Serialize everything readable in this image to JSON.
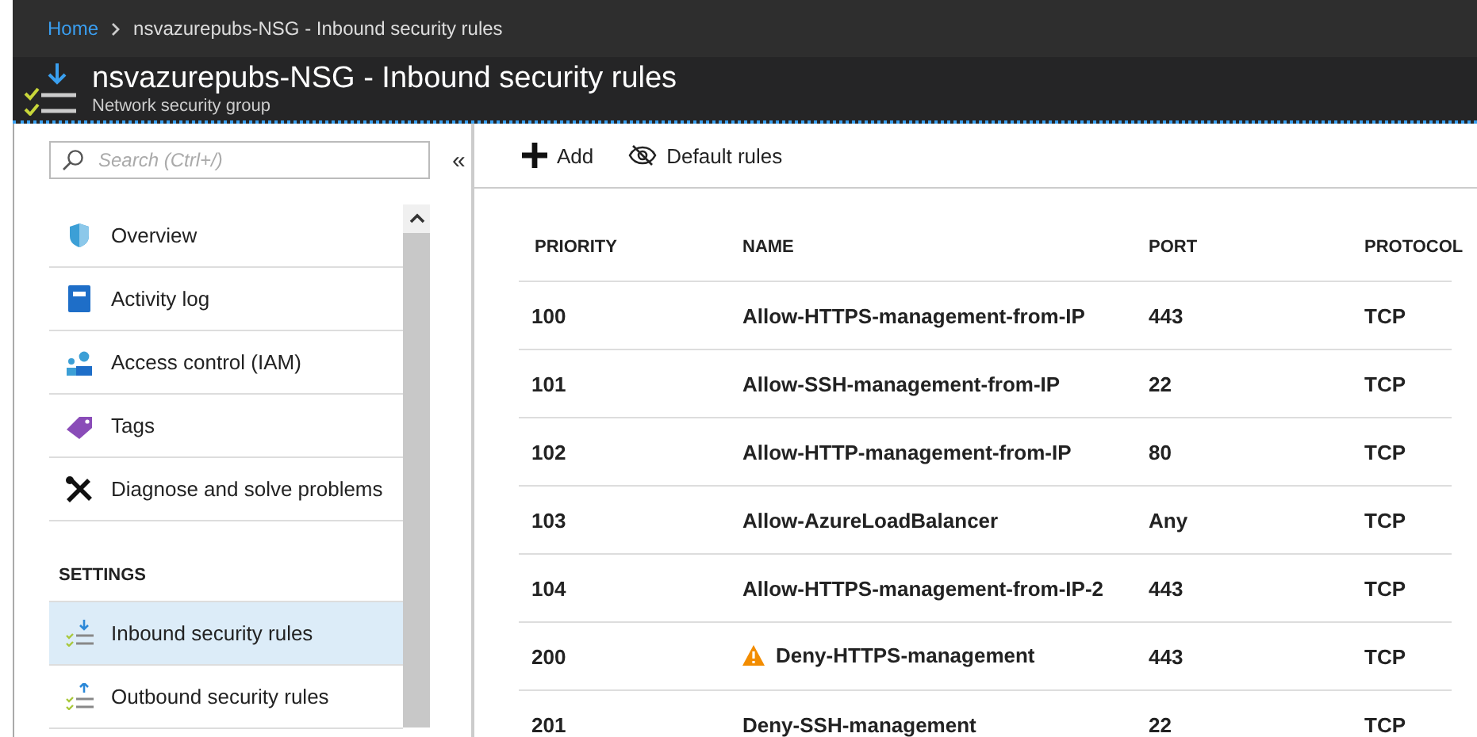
{
  "breadcrumb": {
    "home": "Home",
    "current": "nsvazurepubs-NSG - Inbound security rules"
  },
  "header": {
    "title": "nsvazurepubs-NSG - Inbound security rules",
    "subtitle": "Network security group"
  },
  "search": {
    "placeholder": "Search (Ctrl+/)"
  },
  "collapse": "«",
  "sidebar": {
    "items": [
      {
        "label": "Overview",
        "kind": "shield",
        "selected": false
      },
      {
        "label": "Activity log",
        "kind": "book",
        "selected": false
      },
      {
        "label": "Access control (IAM)",
        "kind": "people",
        "selected": false
      },
      {
        "label": "Tags",
        "kind": "tag",
        "selected": false
      },
      {
        "label": "Diagnose and solve problems",
        "kind": "tools",
        "selected": false
      }
    ],
    "section": "SETTINGS",
    "settings_items": [
      {
        "label": "Inbound security rules",
        "kind": "inbound",
        "selected": true
      },
      {
        "label": "Outbound security rules",
        "kind": "outbound",
        "selected": false
      }
    ]
  },
  "toolbar": [
    {
      "label": "Add",
      "kind": "add"
    },
    {
      "label": "Default rules",
      "kind": "eye"
    }
  ],
  "table": {
    "columns": [
      "PRIORITY",
      "NAME",
      "PORT",
      "PROTOCOL"
    ],
    "rows": [
      {
        "priority": "100",
        "name": "Allow-HTTPS-management-from-IP",
        "port": "443",
        "protocol": "TCP",
        "warning": false
      },
      {
        "priority": "101",
        "name": "Allow-SSH-management-from-IP",
        "port": "22",
        "protocol": "TCP",
        "warning": false
      },
      {
        "priority": "102",
        "name": "Allow-HTTP-management-from-IP",
        "port": "80",
        "protocol": "TCP",
        "warning": false
      },
      {
        "priority": "103",
        "name": "Allow-AzureLoadBalancer",
        "port": "Any",
        "protocol": "TCP",
        "warning": false
      },
      {
        "priority": "104",
        "name": "Allow-HTTPS-management-from-IP-2",
        "port": "443",
        "protocol": "TCP",
        "warning": false
      },
      {
        "priority": "200",
        "name": "Deny-HTTPS-management",
        "port": "443",
        "protocol": "TCP",
        "warning": true
      },
      {
        "priority": "201",
        "name": "Deny-SSH-management",
        "port": "22",
        "protocol": "TCP",
        "warning": false
      }
    ]
  }
}
